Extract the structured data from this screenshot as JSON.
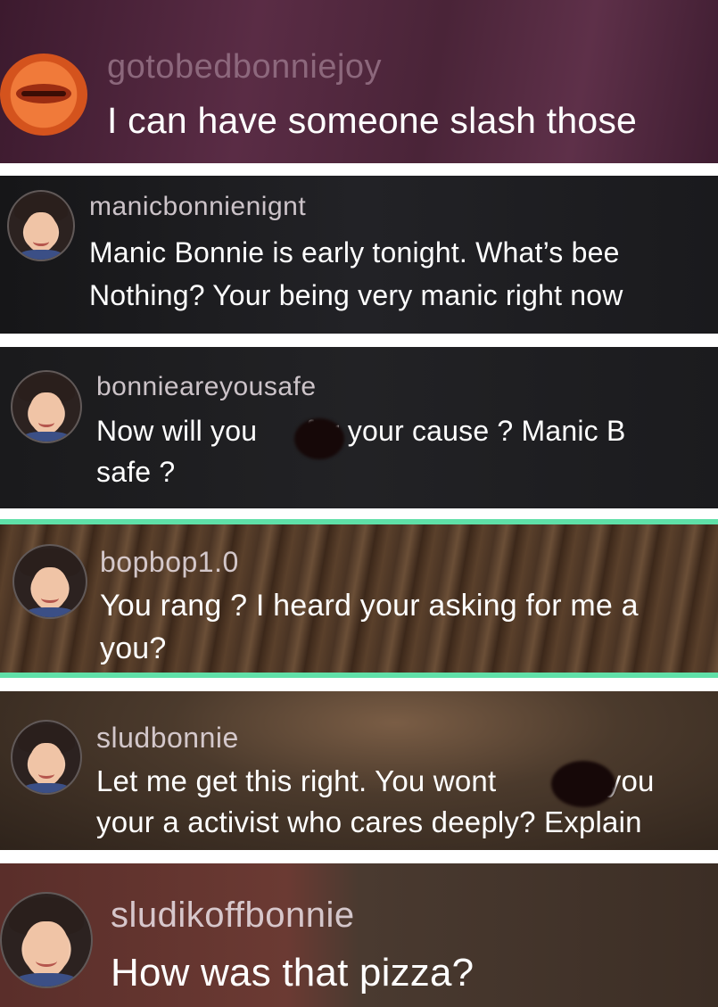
{
  "comments": [
    {
      "username": "gotobedbonniejoy",
      "lines": [
        "I can have someone slash those"
      ]
    },
    {
      "username": "manicbonnienignt",
      "lines": [
        "Manic Bonnie is early tonight. What’s bee",
        "Nothing? Your being very manic right now"
      ]
    },
    {
      "username": "bonnieareyousafe",
      "lines": [
        "Now will you      for your cause ? Manic B",
        "safe ?"
      ]
    },
    {
      "username": "bopbop1.0",
      "lines": [
        "You rang ? I heard your asking for me a",
        "you?"
      ]
    },
    {
      "username": "sludbonnie",
      "lines": [
        "Let me get this right. You wont        for you",
        "your a activist who cares deeply? Explain"
      ]
    },
    {
      "username": "sludikoffbonnie",
      "lines": [
        "How was that pizza?"
      ]
    }
  ],
  "colors": {
    "highlight_border": "#5fe0a8",
    "panel1_bg": "#4a2438",
    "panel2_bg": "#1c1c1e",
    "panel3_bg": "#1d1d20",
    "panel4_bg": "#4a3424",
    "panel5_bg": "#4b3a2c",
    "panel6_bg": "#4a3a30"
  }
}
